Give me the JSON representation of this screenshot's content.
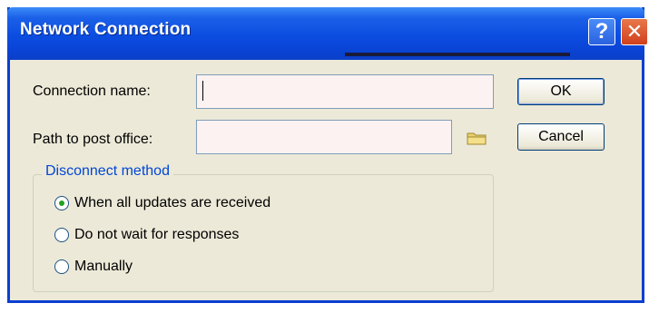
{
  "window": {
    "title": "Network Connection",
    "help_glyph": "?",
    "close_glyph": "✕"
  },
  "fields": {
    "connection_name": {
      "label": "Connection name:",
      "value": ""
    },
    "post_office_path": {
      "label": "Path to post office:",
      "value": ""
    }
  },
  "buttons": {
    "ok": "OK",
    "cancel": "Cancel"
  },
  "disconnect_method": {
    "legend": "Disconnect method",
    "options": [
      {
        "label": "When all updates are received",
        "checked": true
      },
      {
        "label": "Do not wait for responses",
        "checked": false
      },
      {
        "label": "Manually",
        "checked": false
      }
    ]
  },
  "icons": {
    "browse": "folder-icon",
    "help": "help-icon",
    "close": "close-icon"
  },
  "colors": {
    "titlebar": "#0a44d6",
    "dialog_bg": "#ece9d8",
    "group_legend": "#0046d5",
    "close_button": "#d0401c"
  }
}
